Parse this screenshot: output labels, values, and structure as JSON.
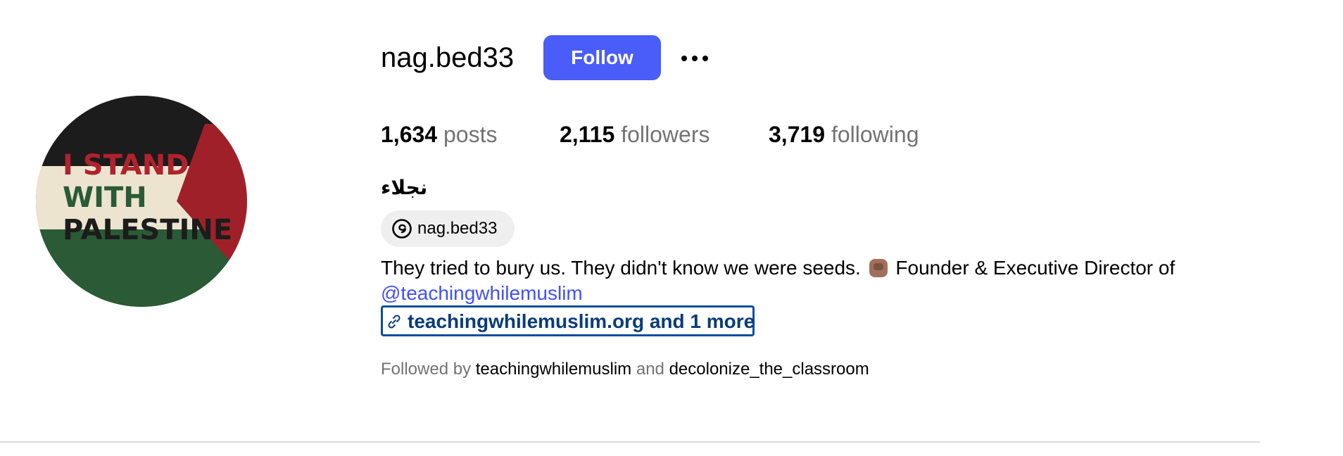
{
  "profile": {
    "username": "nag.bed33",
    "follow_label": "Follow",
    "full_name": "نجلاء",
    "avatar_text": [
      "I STAND",
      "WITH",
      "PALESTINE"
    ],
    "stats": {
      "posts_count": "1,634",
      "posts_label": "posts",
      "followers_count": "2,115",
      "followers_label": "followers",
      "following_count": "3,719",
      "following_label": "following"
    },
    "threads_handle": "nag.bed33",
    "bio_text": "They tried to bury us. They didn't know we were seeds.",
    "bio_text_after": "Founder & Executive Director of",
    "bio_mention": "@teachingwhilemuslim",
    "link_text": "teachingwhilemuslim.org and 1 more",
    "followed_by": {
      "prefix": "Followed by",
      "account_1": "teachingwhilemuslim",
      "joiner": "and",
      "account_2": "decolonize_the_classroom"
    }
  },
  "icons": {
    "more": "more-options-icon",
    "threads": "threads-icon",
    "link": "link-icon",
    "emoji": "raised-fist-emoji"
  },
  "colors": {
    "follow_button": "#4a5df9",
    "mention": "#4150f7",
    "link_focus_border": "#0a4d9e",
    "secondary_text": "#737373",
    "chip_background": "#efefef"
  }
}
